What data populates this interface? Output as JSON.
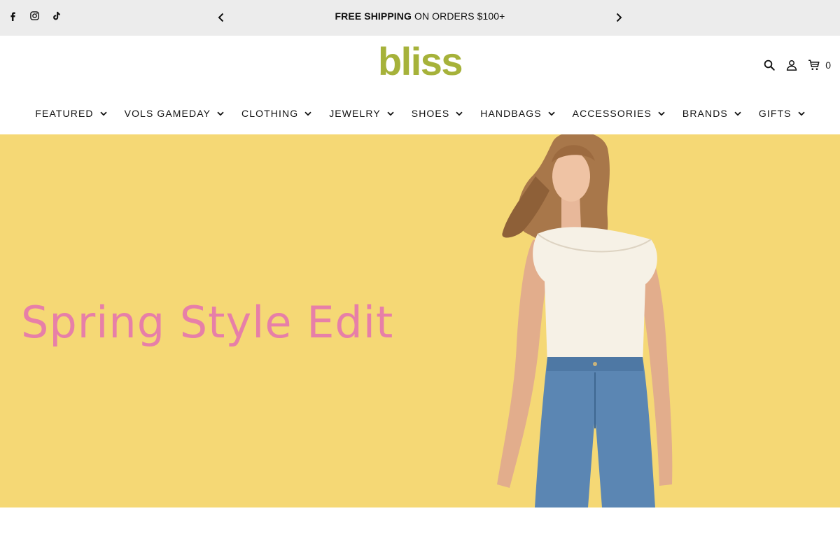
{
  "announcement": {
    "bold_text": "FREE SHIPPING",
    "rest_text": " ON ORDERS $100+",
    "icons": [
      "facebook-icon",
      "instagram-icon",
      "tiktok-icon"
    ],
    "prev_icon": "chevron-left-icon",
    "next_icon": "chevron-right-icon",
    "background": "#ececec"
  },
  "header": {
    "logo_text": "bliss",
    "logo_color": "#a6b23a",
    "cart_count": "0",
    "icons": [
      "search-icon",
      "account-icon",
      "cart-icon"
    ]
  },
  "nav": {
    "items": [
      {
        "label": "FEATURED"
      },
      {
        "label": "VOLS GAMEDAY"
      },
      {
        "label": "CLOTHING"
      },
      {
        "label": "JEWELRY"
      },
      {
        "label": "SHOES"
      },
      {
        "label": "HANDBAGS"
      },
      {
        "label": "ACCESSORIES"
      },
      {
        "label": "BRANDS"
      },
      {
        "label": "GIFTS"
      }
    ]
  },
  "hero": {
    "title": "Spring Style Edit",
    "background": "#f5d875",
    "title_color": "#e77fa8"
  }
}
